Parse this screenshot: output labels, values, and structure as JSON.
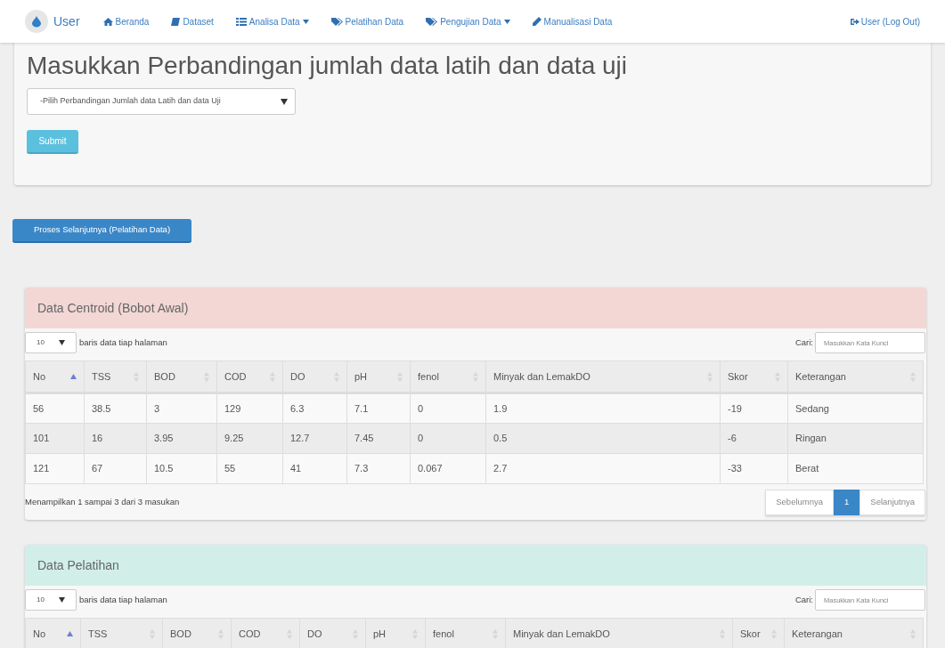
{
  "navbar": {
    "brand": "User",
    "items": [
      {
        "label": "Beranda",
        "dropdown": false
      },
      {
        "label": "Dataset",
        "dropdown": false
      },
      {
        "label": "Analisa Data",
        "dropdown": true
      },
      {
        "label": "Pelatihan Data",
        "dropdown": false
      },
      {
        "label": "Pengujian Data",
        "dropdown": true
      },
      {
        "label": "Manualisasi Data",
        "dropdown": false
      }
    ],
    "user_link": "User (Log Out)"
  },
  "form": {
    "title": "Masukkan Perbandingan jumlah data latih dan data uji",
    "select": "-Pilih Perbandingan Jumlah data Latih dan data Uji",
    "submit": "Submit"
  },
  "next_button": "Proses Selanjutnya (Pelatihan Data)",
  "panels": [
    {
      "title": "Data Centroid (Bobot Awal)",
      "color": "#f2d7d5",
      "page_size": "10",
      "page_size_label": "baris data tiap halaman",
      "search_label": "Cari:",
      "search_placeholder": "Masukkan Kata Kunci",
      "columns": [
        {
          "label": "No",
          "sorted": true
        },
        {
          "label": "TSS",
          "sorted": false
        },
        {
          "label": "BOD",
          "sorted": false
        },
        {
          "label": "COD",
          "sorted": false
        },
        {
          "label": "DO",
          "sorted": false
        },
        {
          "label": "pH",
          "sorted": false
        },
        {
          "label": "fenol",
          "sorted": false
        },
        {
          "label": "Minyak dan LemakDO",
          "sorted": false
        },
        {
          "label": "Skor",
          "sorted": false
        },
        {
          "label": "Keterangan",
          "sorted": false
        }
      ],
      "rows": [
        [
          "56",
          "38.5",
          "3",
          "129",
          "6.3",
          "7.1",
          "0",
          "1.9",
          "-19",
          "Sedang"
        ],
        [
          "101",
          "16",
          "3.95",
          "9.25",
          "12.7",
          "7.45",
          "0",
          "0.5",
          "-6",
          "Ringan"
        ],
        [
          "121",
          "67",
          "10.5",
          "55",
          "41",
          "7.3",
          "0.067",
          "2.7",
          "-33",
          "Berat"
        ]
      ],
      "info": "Menampilkan 1 sampai 3 dari 3 masukan",
      "pagination": [
        {
          "label": "Sebelumnya",
          "selected": false
        },
        {
          "label": "1",
          "selected": true
        },
        {
          "label": "Selanjutnya",
          "selected": false
        }
      ]
    },
    {
      "title": "Data Pelatihan",
      "color": "#d1efe8",
      "page_size": "10",
      "page_size_label": "baris data tiap halaman",
      "search_label": "Cari:",
      "search_placeholder": "Masukkan Kata Kunci",
      "columns": [
        {
          "label": "No",
          "sorted": true
        },
        {
          "label": "TSS",
          "sorted": false
        },
        {
          "label": "BOD",
          "sorted": false
        },
        {
          "label": "COD",
          "sorted": false
        },
        {
          "label": "DO",
          "sorted": false
        },
        {
          "label": "pH",
          "sorted": false
        },
        {
          "label": "fenol",
          "sorted": false
        },
        {
          "label": "Minyak dan LemakDO",
          "sorted": false
        },
        {
          "label": "Skor",
          "sorted": false
        },
        {
          "label": "Keterangan",
          "sorted": false
        }
      ]
    }
  ]
}
